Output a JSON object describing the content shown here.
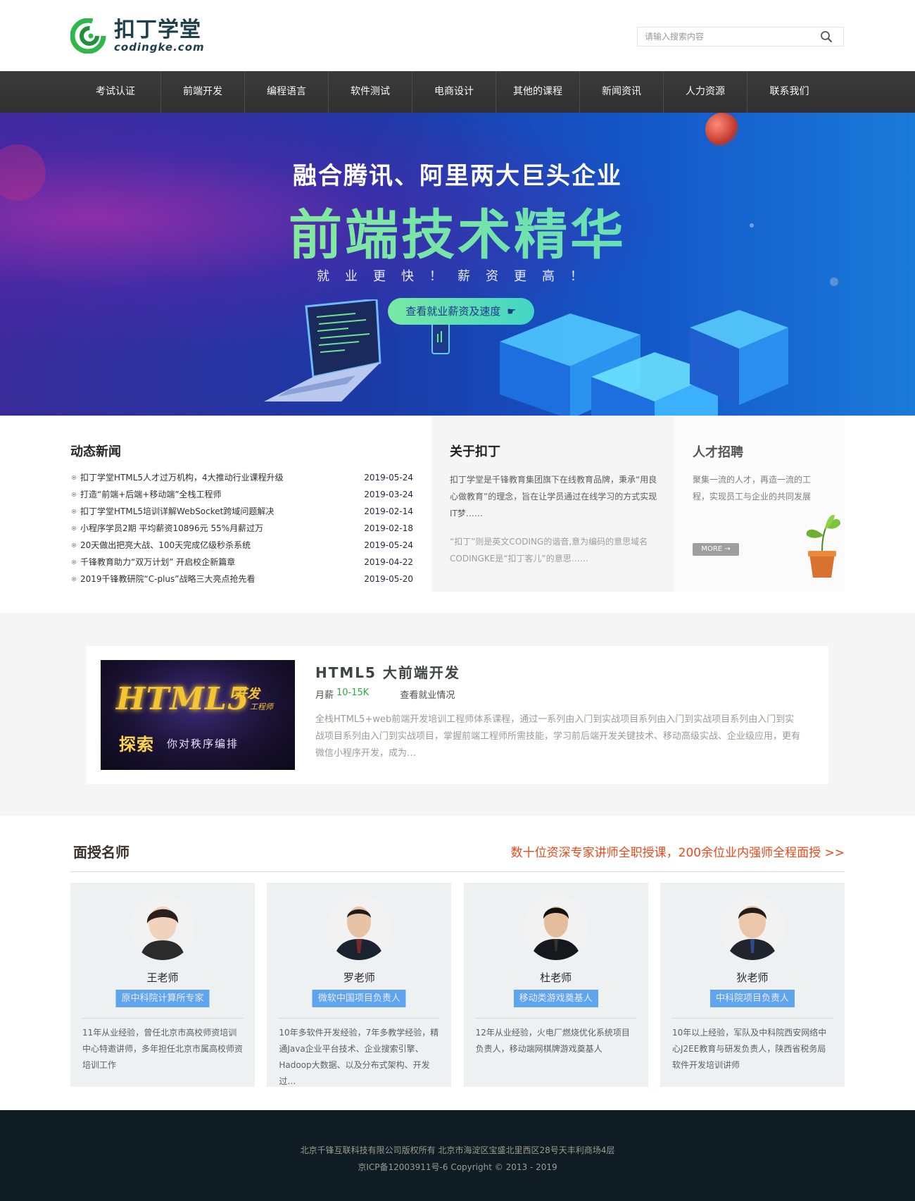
{
  "header": {
    "logo_cn": "扣丁学堂",
    "logo_en": "codingke.com",
    "search_placeholder": "请输入搜索内容",
    "search_icon": "search-icon"
  },
  "nav": {
    "items": [
      "考试认证",
      "前端开发",
      "编程语言",
      "软件测试",
      "电商设计",
      "其他的课程",
      "新闻资讯",
      "人力资源",
      "联系我们"
    ]
  },
  "banner": {
    "headline": "融合腾讯、阿里两大巨头企业",
    "title": "前端技术精华",
    "subtitle": "就业更快！薪资更高！",
    "cta": "查看就业薪资及速度"
  },
  "news": {
    "title": "动态新闻",
    "items": [
      {
        "text": "扣丁学堂HTML5人才过万机构，4大推动行业课程升级",
        "date": "2019-05-24"
      },
      {
        "text": "打造“前端+后端+移动端”全栈工程师",
        "date": "2019-03-24"
      },
      {
        "text": "扣丁学堂HTML5培训详解WebSocket跨域问题解决",
        "date": "2019-02-14"
      },
      {
        "text": "小程序学员2期 平均薪资10896元 55%月薪过万",
        "date": "2019-02-18"
      },
      {
        "text": "20天做出把亮大战、100天完成亿级秒杀系统",
        "date": "2019-05-24"
      },
      {
        "text": "千锋教育助力“双万计划” 开启校企新篇章",
        "date": "2019-04-22"
      },
      {
        "text": "2019千锋教研院“C-plus”战略三大亮点抢先看",
        "date": "2019-05-20"
      }
    ]
  },
  "about": {
    "title": "关于扣丁",
    "p1": "扣丁学堂是千锋教育集团旗下在线教育品牌，秉承“用良心做教育”的理念，旨在让学员通过在线学习的方式实现IT梦……",
    "p2": "“扣丁”则是英文CODING的谐音,意为编码的意思域名CODINGKE是“扣丁客儿”的意思……"
  },
  "hr": {
    "title": "人才招聘",
    "text": "聚集一流的人才，再造一流的工程，实现员工与企业的共同发展",
    "more": "MORE →"
  },
  "course": {
    "title": "HTML5 大前端开发",
    "salary_label": "月薪",
    "salary": "10-15K",
    "link": "查看就业情况",
    "desc": "全栈HTML5+web前端开发培训工程师体系课程，通过一系列由入门到实战项目系列由入门到实战项目系列由入门到实战项目系列由入门到实战项目，掌握前端工程师所需技能，学习前后端开发关键技术、移动高级实战、企业级应用，更有微信小程序开发，成为…",
    "image_title": "HTML5",
    "image_tag": "开发",
    "image_tag2": "工程师",
    "image_explore": "探索",
    "image_sub": "你对秩序编排"
  },
  "teachers": {
    "title": "面授名师",
    "slogan": "数十位资深专家讲师全职授课，200余位业内强师全程面授 >>",
    "items": [
      {
        "name": "王老师",
        "role": "原中科院计算所专家",
        "desc": "11年从业经验，曾任北京市高校师资培训中心特邀讲师，多年担任北京市属高校师资培训工作"
      },
      {
        "name": "罗老师",
        "role": "微软中国项目负责人",
        "desc": "10年多软件开发经验，7年多教学经验，精通Java企业平台技术、企业搜索引擎、Hadoop大数据、以及分布式架构、开发过…"
      },
      {
        "name": "杜老师",
        "role": "移动类游戏奠基人",
        "desc": "12年从业经验，火电厂燃烧优化系统项目负责人，移动端网棋牌游戏奠基人"
      },
      {
        "name": "狄老师",
        "role": "中科院项目负责人",
        "desc": "10年以上经验，军队及中科院西安网络中心J2EE教育与研发负责人，陕西省税务局软件开发培训讲师"
      }
    ]
  },
  "footer": {
    "line1": "北京千锋互联科技有限公司版权所有  北京市海淀区宝盛北里西区28号天丰利商场4层",
    "line2": "京ICP备12003911号-6   Copyright © 2013 - 2019"
  },
  "colors": {
    "nav_bg": "#313131",
    "nav_divider": "#4b4b4b",
    "accent_green": "#29ad43",
    "slogan_red": "#ed4819",
    "badge_blue": "#5fa5ed",
    "footer_bg": "#101c23"
  }
}
